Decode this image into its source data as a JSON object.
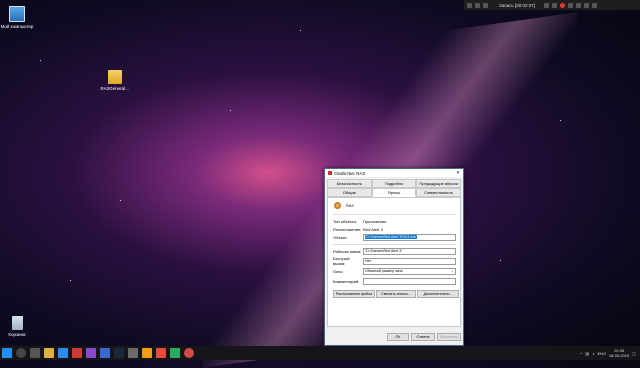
{
  "desktop": {
    "icons": [
      {
        "label": "Мой компьютер",
        "icon": "computer-icon"
      },
      {
        "label": "RA3General…",
        "icon": "folder-icon"
      },
      {
        "label": "Корзина",
        "icon": "recycle-bin-icon"
      }
    ]
  },
  "recorder": {
    "label": "Запись [00:02:37]"
  },
  "dialog": {
    "title": "Свойства: RA3",
    "tabs_top": [
      "Безопасность",
      "Подробно",
      "Предыдущие версии"
    ],
    "tabs_bottom": [
      "Общие",
      "Ярлык",
      "Совместимость"
    ],
    "app_name": "RA3",
    "fields": {
      "type_label": "Тип объекта:",
      "type_value": "Приложение",
      "location_label": "Расположение:",
      "location_value": "Red Alert 3",
      "target_label": "Объект:",
      "target_value": "\"D:\\Games\\Red Alert 3\\RA3.exe\"",
      "workdir_label": "Рабочая папка:",
      "workdir_value": "\"D:\\Games\\Red Alert 3\"",
      "hotkey_label": "Быстрый вызов:",
      "hotkey_value": "Нет",
      "window_label": "Окно:",
      "window_value": "Обычный размер окна",
      "comment_label": "Комментарий:",
      "comment_value": ""
    },
    "buttons": {
      "open_location": "Расположение файла",
      "change_icon": "Сменить значок...",
      "advanced": "Дополнительно...",
      "ok": "ОК",
      "cancel": "Отмена",
      "apply": "Применить"
    }
  },
  "taskbar": {
    "language": "ENG",
    "time": "22:45",
    "date": "06.05.2019"
  }
}
